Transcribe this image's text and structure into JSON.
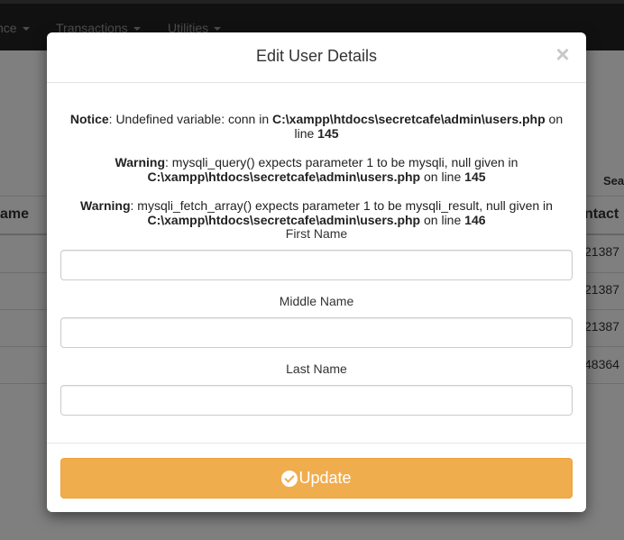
{
  "nav": {
    "items": [
      {
        "label": "nce"
      },
      {
        "label": "Transactions"
      },
      {
        "label": "Utilities"
      }
    ]
  },
  "background": {
    "search_label": "Sea",
    "col_left_header": "ame",
    "col_right_header": "ntact",
    "rows": [
      {
        "contact": "21387"
      },
      {
        "contact": "21387"
      },
      {
        "contact": "21387"
      },
      {
        "contact": "48364"
      }
    ]
  },
  "modal": {
    "title": "Edit User Details",
    "close_symbol": "×",
    "messages": [
      {
        "level": "Notice",
        "text": ": Undefined variable: conn in ",
        "path": "C:\\xampp\\htdocs\\secretcafe\\admin\\users.php",
        "on_line": " on line ",
        "line": "145"
      },
      {
        "level": "Warning",
        "text": ": mysqli_query() expects parameter 1 to be mysqli, null given in ",
        "path": "C:\\xampp\\htdocs\\secretcafe\\admin\\users.php",
        "on_line": " on line ",
        "line": "145"
      },
      {
        "level": "Warning",
        "text": ": mysqli_fetch_array() expects parameter 1 to be mysqli_result, null given in ",
        "path": "C:\\xampp\\htdocs\\secretcafe\\admin\\users.php",
        "on_line": " on line ",
        "line": "146"
      }
    ],
    "fields": {
      "first_name": {
        "label": "First Name",
        "value": ""
      },
      "middle_name": {
        "label": "Middle Name",
        "value": ""
      },
      "last_name": {
        "label": "Last Name",
        "value": ""
      }
    },
    "update_label": "Update"
  },
  "colors": {
    "navbar": "#222222",
    "warning_button": "#f0ad4e",
    "backdrop": "rgba(0,0,0,0.5)"
  }
}
